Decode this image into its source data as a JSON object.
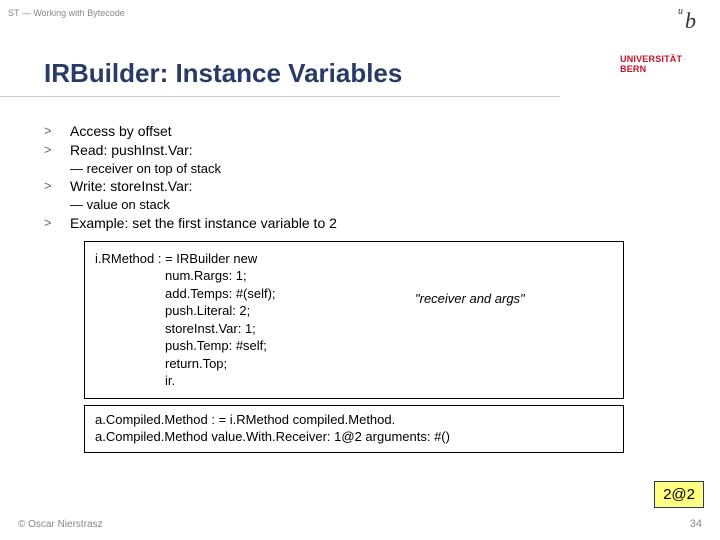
{
  "header": {
    "breadcrumb": "ST — Working with Bytecode"
  },
  "logo": {
    "mark": "b",
    "sup": "u",
    "uni1": "UNIVERSITÄT",
    "uni2": "BERN"
  },
  "title": "IRBuilder: Instance Variables",
  "bullets": {
    "b1": "Access by offset",
    "b2": "Read: pushInst.Var:",
    "b2s": "—  receiver on top of stack",
    "b3": "Write: storeInst.Var:",
    "b3s": "—  value on stack",
    "b4": "Example: set the first instance variable to 2"
  },
  "code1": {
    "l1": "i.RMethod : = IRBuilder new",
    "l2": "num.Rargs: 1;",
    "l3": "add.Temps: #(self);",
    "l4": "push.Literal: 2;",
    "l5": "storeInst.Var: 1;",
    "l6": "push.Temp: #self;",
    "l7": "return.Top;",
    "l8": "ir.",
    "annot": "\"receiver and args\""
  },
  "code2": {
    "l1": "a.Compiled.Method : = i.RMethod compiled.Method.",
    "l2": "a.Compiled.Method value.With.Receiver: 1@2 arguments: #()"
  },
  "result": "2@2",
  "footer": {
    "copyright": "© Oscar Nierstrasz",
    "page": "34"
  },
  "glyphs": {
    "gt": ">"
  }
}
